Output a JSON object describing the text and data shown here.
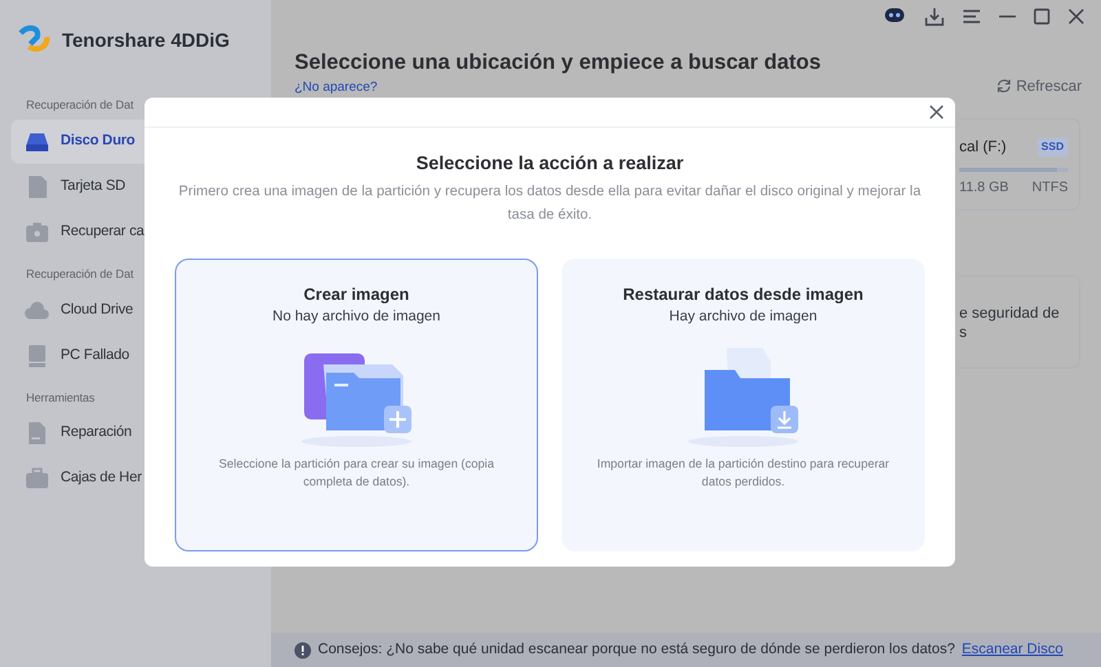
{
  "app": {
    "name": "Tenorshare 4DDiG"
  },
  "sidebar": {
    "sections": [
      {
        "title": "Recuperación de Dat",
        "items": [
          {
            "label": "Disco Duro",
            "kind": "disk",
            "selected": true
          },
          {
            "label": "Tarjeta SD",
            "kind": "sd",
            "selected": false
          },
          {
            "label": "Recuperar ca",
            "kind": "camera",
            "selected": false
          }
        ]
      },
      {
        "title": "Recuperación de Dat",
        "items": [
          {
            "label": "Cloud Drive",
            "kind": "cloud",
            "selected": false
          },
          {
            "label": "PC Fallado",
            "kind": "pc",
            "selected": false
          }
        ]
      },
      {
        "title": "Herramientas",
        "items": [
          {
            "label": "Reparación",
            "kind": "file",
            "selected": false
          },
          {
            "label": "Cajas de Her",
            "kind": "toolbox",
            "selected": false
          }
        ]
      }
    ]
  },
  "main": {
    "title": "Seleccione una ubicación y empiece a buscar datos",
    "link": "¿No aparece?",
    "refresh": "Refrescar",
    "drive": {
      "name": "cal (F:)",
      "badge": "SSD",
      "level": 0.9,
      "size": "11.8 GB",
      "fs": "NTFS"
    },
    "card_text": [
      "e seguridad de",
      "s"
    ]
  },
  "dialog": {
    "title": "Seleccione la acción a realizar",
    "subtitle": "Primero crea una imagen de la partición y recupera los datos desde ella para evitar dañar el disco original y mejorar la tasa de éxito.",
    "options": [
      {
        "kind": "create",
        "title": "Crear imagen",
        "subtitle": "No hay archivo de imagen",
        "description": "Seleccione la partición para crear su imagen (copia completa de datos).",
        "selected": true
      },
      {
        "kind": "restore",
        "title": "Restaurar datos desde imagen",
        "subtitle": "Hay archivo de imagen",
        "description": "Importar imagen de la partición destino para recuperar datos perdidos.",
        "selected": false
      }
    ]
  },
  "tip": {
    "text": "Consejos: ¿No sabe qué unidad escanear porque no está seguro de dónde se perdieron los datos?",
    "link": "Escanear Disco"
  }
}
